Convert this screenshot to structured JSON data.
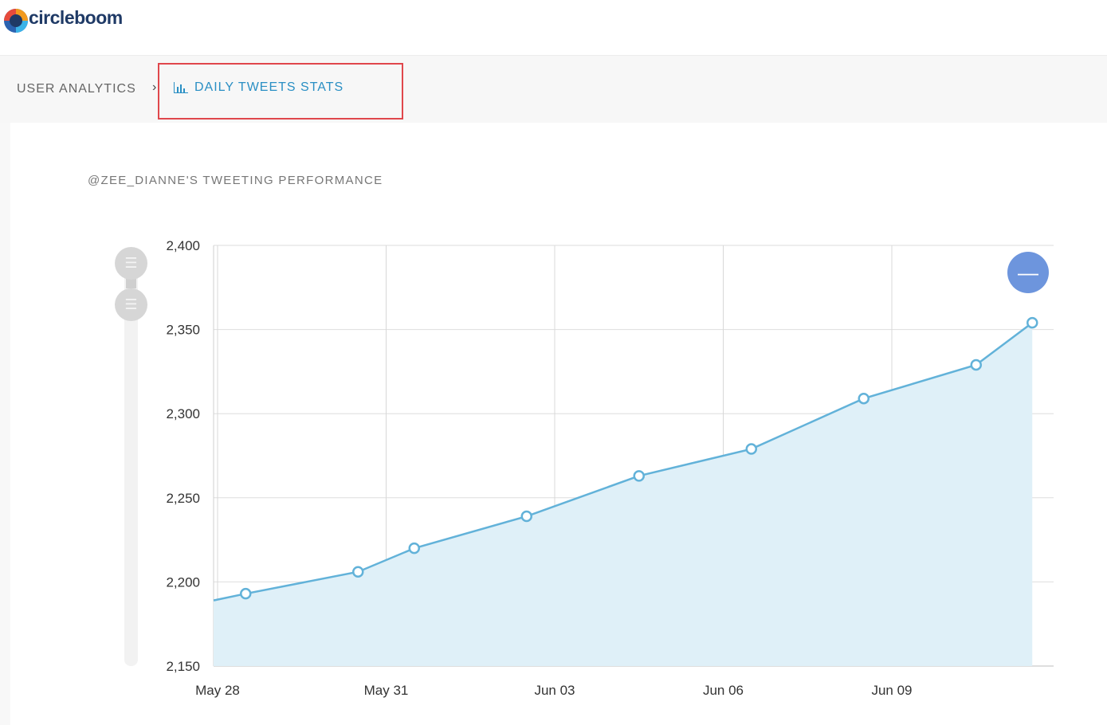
{
  "header": {
    "logo_text": "circleboom"
  },
  "breadcrumb": {
    "root_label": "USER ANALYTICS",
    "separator": "›",
    "current_label": "DAILY TWEETS STATS",
    "current_icon": "bar-chart-icon"
  },
  "chart_panel": {
    "title": "@ZEE_DIANNE'S TWEETING PERFORMANCE",
    "zoom_button_symbol": "—",
    "scroll_handle_symbol": "☰"
  },
  "colors": {
    "line": "#62b2d9",
    "area": "#dff0f8",
    "highlight": "#e0474c",
    "link": "#2a8fc4",
    "zoom": "#6d95dd"
  },
  "chart_data": {
    "type": "area",
    "x": [
      "May 27",
      "May 28",
      "May 30",
      "May 31",
      "Jun 02",
      "Jun 04",
      "Jun 06",
      "Jun 08",
      "Jun 10",
      "Jun 11"
    ],
    "x_day_offsets_from_may28": [
      -0.25,
      0.5,
      2.5,
      3.5,
      5.5,
      7.5,
      9.5,
      11.5,
      13.5,
      14.5
    ],
    "values": [
      2189,
      2193,
      2206,
      2220,
      2239,
      2263,
      2279,
      2309,
      2329,
      2354
    ],
    "markers": [
      false,
      true,
      true,
      true,
      true,
      true,
      true,
      true,
      true,
      true
    ],
    "xticks": [
      "May 28",
      "May 31",
      "Jun 03",
      "Jun 06",
      "Jun 09"
    ],
    "yticks": [
      "2,150",
      "2,200",
      "2,250",
      "2,300",
      "2,350",
      "2,400"
    ],
    "ylim": [
      2150,
      2400
    ],
    "grid": true,
    "legend": "none"
  }
}
